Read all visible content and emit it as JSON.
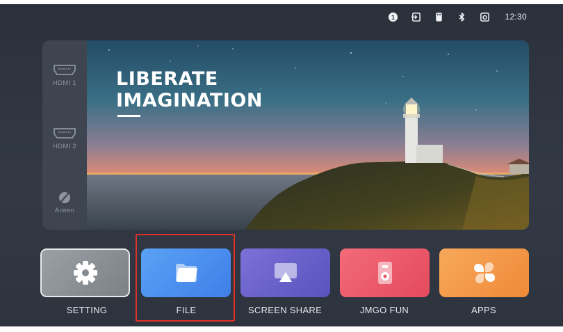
{
  "statusbar": {
    "icons": [
      "notification-badge-icon",
      "input-source-icon",
      "usb-storage-icon",
      "bluetooth-icon",
      "screen-capture-icon"
    ],
    "notification_count": "1",
    "time": "12:30"
  },
  "sources": [
    {
      "label": "HDMI 1",
      "icon": "hdmi-port-icon"
    },
    {
      "label": "HDMI 2",
      "icon": "hdmi-port-icon"
    },
    {
      "label": "Arwen",
      "icon": "arwen-logo-icon"
    }
  ],
  "banner": {
    "title_line1": "LIBERATE",
    "title_line2": "IMAGINATION"
  },
  "apps": [
    {
      "label": "SETTING",
      "icon": "gear-icon",
      "color": "#8b9096"
    },
    {
      "label": "FILE",
      "icon": "folder-icon",
      "color": "#4a8df0"
    },
    {
      "label": "SCREEN SHARE",
      "icon": "screen-share-icon",
      "color": "#6a62c8"
    },
    {
      "label": "JMGO FUN",
      "icon": "speaker-icon",
      "color": "#ee5a6a"
    },
    {
      "label": "APPS",
      "icon": "four-petal-apps-icon",
      "color": "#f39a4a"
    }
  ],
  "focused_app": "FILE",
  "colors": {
    "background": "#2f3540",
    "focus_ring": "#e0302a",
    "text": "#e4e7ec"
  }
}
